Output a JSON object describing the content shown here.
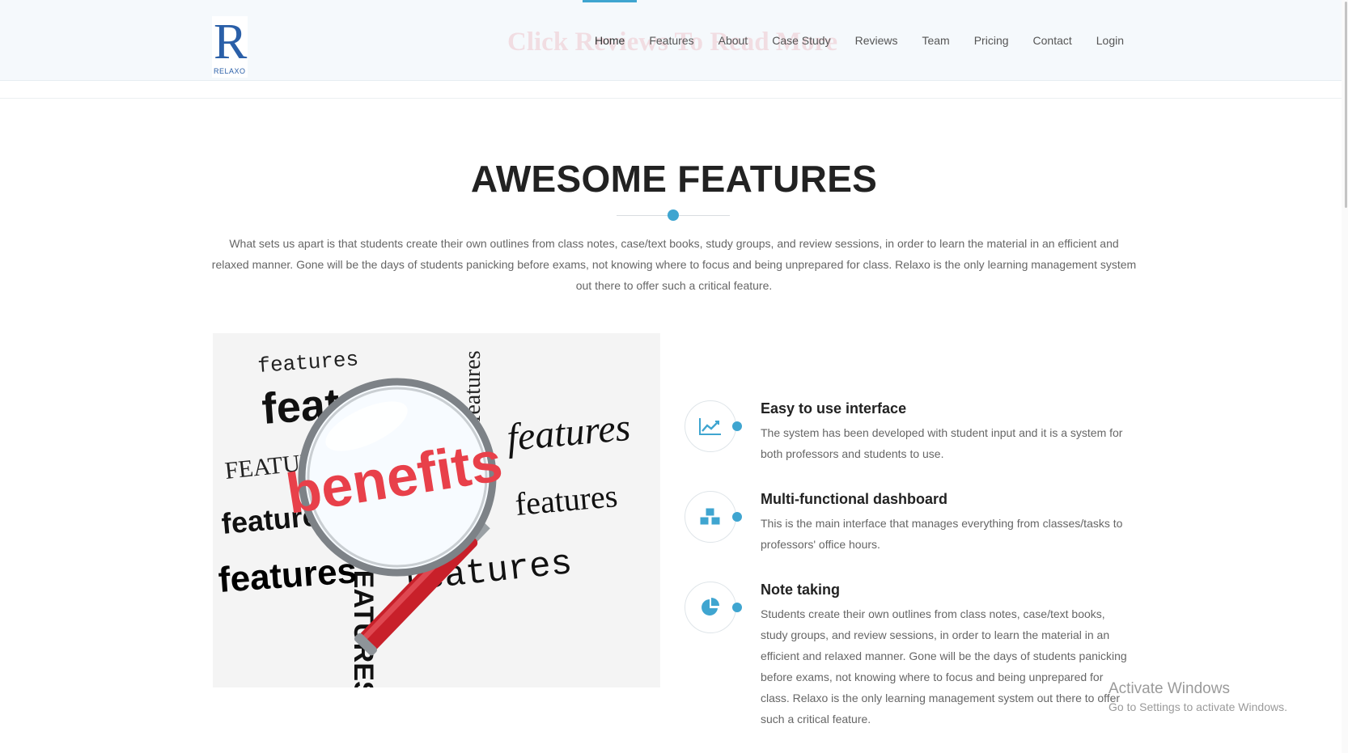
{
  "header": {
    "logo_letter": "R",
    "logo_text": "RELAXO",
    "ghost_banner": "Click Reviews To Read More",
    "nav": [
      {
        "label": "Home",
        "active": true
      },
      {
        "label": "Features"
      },
      {
        "label": "About"
      },
      {
        "label": "Case Study"
      },
      {
        "label": "Reviews"
      },
      {
        "label": "Team"
      },
      {
        "label": "Pricing"
      },
      {
        "label": "Contact"
      },
      {
        "label": "Login"
      }
    ]
  },
  "section": {
    "title": "AWESOME FEATURES",
    "intro": "What sets us apart is that students create their own outlines from class notes, case/text books, study groups, and review sessions, in order to learn the material in an efficient and relaxed manner. Gone will be the days of students panicking before exams, not knowing where to focus and being unprepared for class. Relaxo is the only learning management system out there to offer such a critical feature."
  },
  "image": {
    "center_word": "benefits",
    "words": [
      "features",
      "features",
      "features",
      "FEATURES",
      "features",
      "features",
      "features",
      "FEATURES",
      "features",
      "features"
    ]
  },
  "features": [
    {
      "icon": "line-chart-icon",
      "title": "Easy to use interface",
      "desc": "The system has been developed with student input and it is a system for both professors and students to use."
    },
    {
      "icon": "cubes-icon",
      "title": "Multi-functional dashboard",
      "desc": "This is the main interface that manages everything from classes/tasks to professors' office hours."
    },
    {
      "icon": "pie-chart-icon",
      "title": "Note taking",
      "desc": "Students create their own outlines from class notes, case/text books, study groups, and review sessions, in order to learn the material in an efficient and relaxed manner. Gone will be the days of students panicking before exams, not knowing where to focus and being unprepared for class. Relaxo is the only learning management system out there to offer such a critical feature."
    }
  ],
  "watermark": {
    "title": "Activate Windows",
    "subtitle": "Go to Settings to activate Windows."
  },
  "colors": {
    "accent": "#3fa5d0",
    "brand": "#2a5fa8",
    "magnifier_handle": "#c8202a",
    "benefits_text": "#e8404a"
  }
}
